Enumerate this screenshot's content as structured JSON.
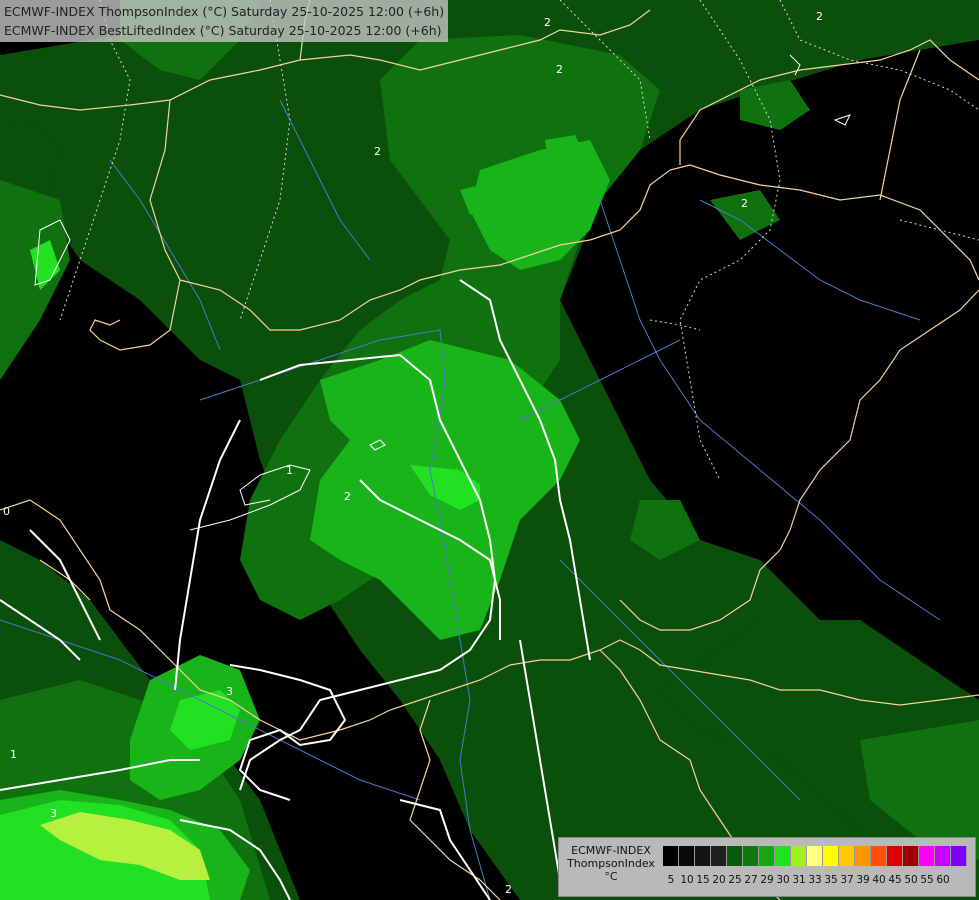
{
  "header": {
    "line1": "ECMWF-INDEX ThompsonIndex (°C) Saturday 25-10-2025 12:00 (+6h)",
    "line2": "ECMWF-INDEX BestLiftedIndex (°C) Saturday 25-10-2025 12:00 (+6h)"
  },
  "legend": {
    "title_line1": "ECMWF-INDEX",
    "title_line2": "ThompsonIndex",
    "unit": "°C",
    "ticks": [
      "5",
      "10",
      "15",
      "20",
      "25",
      "27",
      "29",
      "30",
      "31",
      "33",
      "35",
      "37",
      "39",
      "40",
      "45",
      "50",
      "55",
      "60"
    ],
    "colors": [
      "#000000",
      "#0a0a0a",
      "#141414",
      "#1e1e1e",
      "#0b5a0b",
      "#0f780f",
      "#17a517",
      "#22e022",
      "#a0f020",
      "#ffff80",
      "#ffff00",
      "#ffc800",
      "#ff9600",
      "#ff5000",
      "#e00000",
      "#a00000",
      "#ff00ff",
      "#c800ff",
      "#8000ff",
      "#5000ff",
      "#0000ff"
    ]
  },
  "contour_labels": [
    "2",
    "2",
    "2",
    "2",
    "2",
    "1",
    "2",
    "3",
    "1",
    "3",
    "2",
    "0"
  ],
  "colors": {
    "dark_green": "#0a4f0a",
    "mid_green": "#0f720f",
    "bright_green": "#19b419",
    "lime": "#22e022",
    "yellow_green": "#b8f040",
    "border": "#f5d3a0",
    "river": "#4e78c8",
    "contour": "#ffffff"
  }
}
